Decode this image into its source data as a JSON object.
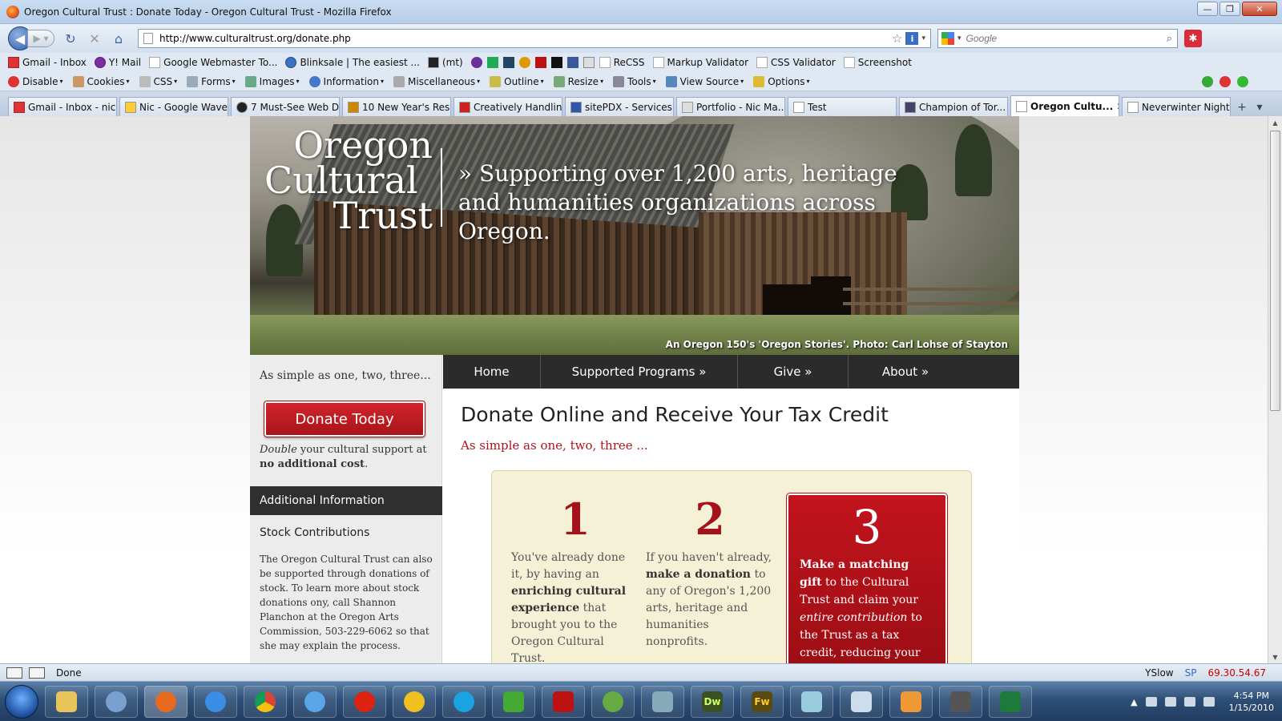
{
  "window": {
    "title": "Oregon Cultural Trust : Donate Today - Oregon Cultural Trust - Mozilla Firefox"
  },
  "navbar": {
    "url": "http://www.culturaltrust.org/donate.php",
    "search_placeholder": "Google"
  },
  "bookmarks": [
    "Gmail - Inbox",
    "Y! Mail",
    "Google Webmaster To...",
    "Blinksale | The easiest ...",
    "(mt)",
    "ReCSS",
    "Markup Validator",
    "CSS Validator",
    "Screenshot"
  ],
  "webdev": [
    "Disable",
    "Cookies",
    "CSS",
    "Forms",
    "Images",
    "Information",
    "Miscellaneous",
    "Outline",
    "Resize",
    "Tools",
    "View Source",
    "Options"
  ],
  "tabs": [
    "Gmail - Inbox - nic...",
    "Nic - Google Wave",
    "7 Must-See Web D...",
    "10 New Year's Res...",
    "Creatively Handlin...",
    "sitePDX - Services ...",
    "Portfolio - Nic Ma...",
    "Test",
    "Champion of Tor...",
    "Oregon Cultu...",
    "Neverwinter Night..."
  ],
  "site": {
    "logo": {
      "line1": "Oregon",
      "line2": "Cultural",
      "line3": "Trust"
    },
    "tagline": "» Supporting over 1,200 arts, heritage and humanities organizations across Oregon.",
    "photo_credit": "An Oregon 150's 'Oregon Stories'. Photo: Carl Lohse of Stayton",
    "nav": [
      "Home",
      "Supported Programs »",
      "Give »",
      "About »"
    ],
    "sidebar": {
      "intro": "As simple as one, two, three...",
      "donate_button": "Donate Today",
      "double_em": "Double",
      "double_mid": " your cultural support at ",
      "double_strong": "no additional cost",
      "double_end": ".",
      "additional_heading": "Additional Information",
      "stock_heading": "Stock Contributions",
      "stock_text": "The Oregon Cultural Trust can also be supported through donations of stock. To learn more about stock donations ony, call Shannon Planchon at the Oregon Arts Commission, 503-229-6062 so that she may explain the process."
    },
    "main": {
      "heading": "Donate Online and Receive Your Tax Credit",
      "subheading": "As simple as one, two, three ...",
      "steps": [
        {
          "num": "1",
          "a": "You've already done it, by having an ",
          "b": "enriching cultural experience",
          "c": " that brought you to the Oregon Cultural Trust."
        },
        {
          "num": "2",
          "a": "If you haven't already, ",
          "b": "make a donation",
          "c": " to any of Oregon's 1,200 arts, heritage and humanities nonprofits."
        },
        {
          "num": "3",
          "a": "Make a matching gift",
          "b": " to the Cultural Trust and claim your ",
          "c": "entire contribution",
          "d": " to the Trust as a tax credit, reducing your Oregon tax bill."
        }
      ]
    }
  },
  "statusbar": {
    "text": "Done",
    "yslow": "YSlow",
    "sp": "SP",
    "ip": "69.30.54.67"
  },
  "taskbar": {
    "apps": [
      "Dw",
      "Fw"
    ],
    "time": "4:54 PM",
    "date": "1/15/2010"
  }
}
